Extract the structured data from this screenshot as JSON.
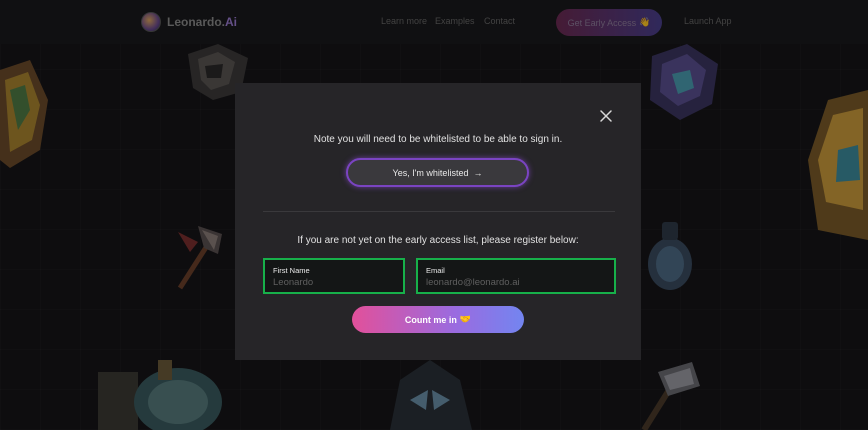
{
  "nav": {
    "logo_text": "Leonardo.",
    "logo_accent": "Ai",
    "links": [
      "Learn more",
      "Examples",
      "Contact"
    ],
    "cta_label": "Get Early Access",
    "cta_emoji": "👋",
    "launch_label": "Launch App"
  },
  "modal": {
    "note": "Note you will need to be whitelisted to be able to sign in.",
    "whitelisted_label": "Yes, I'm whitelisted",
    "whitelisted_arrow": "→",
    "register_text": "If you are not yet on the early access list, please register below:",
    "first_name": {
      "label": "First Name",
      "placeholder": "Leonardo",
      "value": ""
    },
    "email": {
      "label": "Email",
      "placeholder": "leonardo@leonardo.ai",
      "value": ""
    },
    "submit_label": "Count me in",
    "submit_emoji": "🤝"
  },
  "colors": {
    "page_bg": "#161518",
    "modal_bg": "#262528",
    "field_border": "#17b04a",
    "button_glow": "#7a44c2",
    "submit_gradient_start": "#e2509a",
    "submit_gradient_end": "#7385f0"
  },
  "icons": {
    "close": "close-icon",
    "arrow": "arrow-right-icon",
    "handshake": "handshake-icon",
    "wave": "waving-hand-icon"
  }
}
